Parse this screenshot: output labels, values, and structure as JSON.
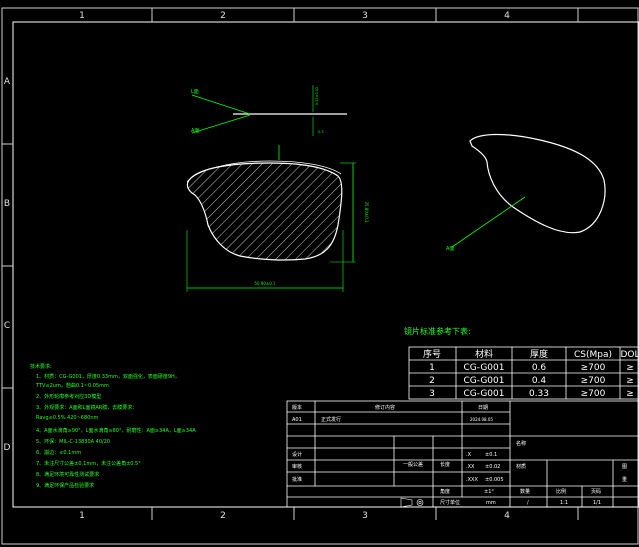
{
  "sheet": {
    "columns": [
      "1",
      "2",
      "3",
      "4"
    ],
    "rows": [
      "A",
      "B",
      "C",
      "D"
    ]
  },
  "section_view": {
    "label_l": "L面",
    "label_a": "A面",
    "dim_thickness": "0.33±0.02",
    "dim_offset": "0.3",
    "dim_height": "35.80±0.1",
    "dim_width": "50.90±0.1"
  },
  "side_view": {
    "label_a": "A面"
  },
  "params_table": {
    "title": "镜片标准参考下表:",
    "headers": [
      "序号",
      "材料",
      "厚度",
      "CS(Mpa)",
      "DOL"
    ],
    "rows": [
      [
        "1",
        "CG-G001",
        "0.6",
        "≥700",
        "≥"
      ],
      [
        "2",
        "CG-G001",
        "0.4",
        "≥700",
        "≥"
      ],
      [
        "3",
        "CG-G001",
        "0.33",
        "≥700",
        "≥"
      ]
    ]
  },
  "tech_requirements": {
    "title": "技术要求:",
    "items": [
      "1、材质：CG-G001，厚度0.33mm，双面强化，表面硬度9H，",
      "   TTV≤2um，翘曲0.1~0.05mm",
      "2、外形轮廓参考对应3D模型",
      "3、外观要求：A面和L面镜AR膜，去膜要求：",
      "   Ravg≤0.5% 420~680nm",
      "4、A面水滴角≥90°，L面水滴角≥80°，耐磨性：A面≥34A，L面≥34A",
      "5、环保：MIL-C-13830A 40/20",
      "6、崩边：≤0.1mm",
      "7、未注尺寸公差±0.1mm，未注公差角±0.5°",
      "8、满足环境可靠性测试要求",
      "9、满足环保产品检验要求"
    ]
  },
  "revision_block": {
    "headers": [
      "版本",
      "修订内容",
      "日期"
    ],
    "rows": [
      [
        "A01",
        "正式发行",
        "2024.08.05"
      ]
    ]
  },
  "title_block": {
    "design": "设计",
    "check": "审核",
    "review": "批准",
    "approve": "批准",
    "general_tol_label": "一般公差",
    "length_label": "长度",
    "angle_label": "角度",
    "tol_rows": [
      [
        ".X",
        "±0.1"
      ],
      [
        ".XX",
        "±0.02"
      ],
      [
        ".XXX",
        "±0.005"
      ]
    ],
    "angle_tol": "±1°",
    "unit_label": "尺寸单位",
    "unit_value": "mm",
    "qty_label": "数量",
    "scale_label": "比例",
    "scale_value": "1:1",
    "sheet_label": "页码",
    "sheet_value": "1/1",
    "qty_value": "/",
    "name_label": "名称",
    "material_label": "材质",
    "drawing_no": "图",
    "misc": "重"
  }
}
